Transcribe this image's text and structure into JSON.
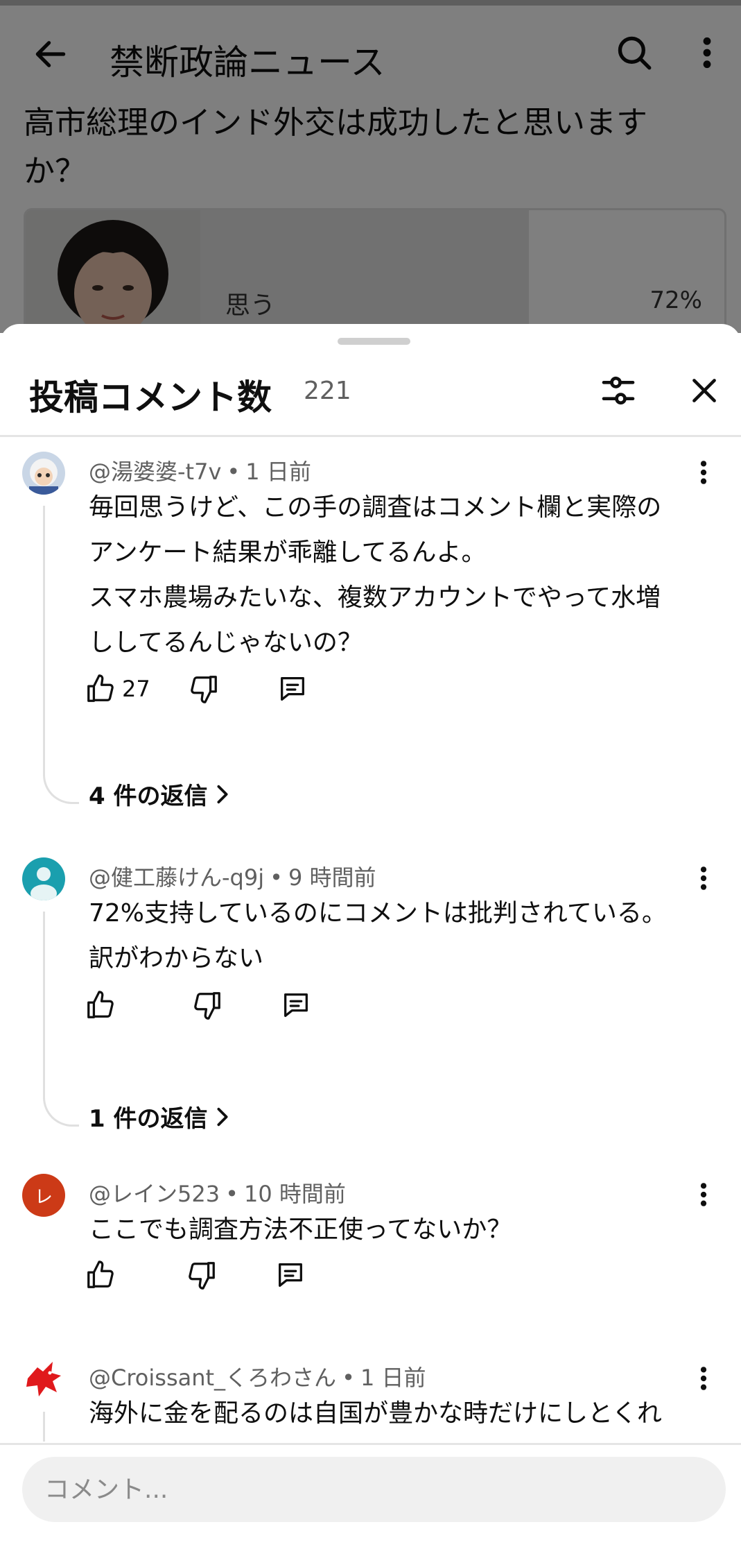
{
  "app": {
    "title": "禁断政論ニュース"
  },
  "post": {
    "question": "高市総理のインド外交は成功したと思いますか？",
    "poll": {
      "option_label": "思う",
      "percent_text": "72%",
      "percent_value": 72
    }
  },
  "sheet": {
    "title": "投稿コメント数",
    "count": "221"
  },
  "comments": [
    {
      "author": "@湯婆婆-t7v",
      "time": "1 日前",
      "text": "毎回思うけど、この手の調査はコメント欄と実際のアンケート結果が乖離してるんよ。\nスマホ農場みたいな、複数アカウントでやって水増ししてるんじゃないの？",
      "likes": "27",
      "replies": "4 件の返信",
      "avatar_icon": "cartoon-character-avatar"
    },
    {
      "author": "@健工藤けん-q9j",
      "time": "9 時間前",
      "text": "72%支持しているのにコメントは批判されている。\n訳がわからない",
      "likes": "",
      "replies": "1 件の返信",
      "avatar_icon": "default-person-avatar"
    },
    {
      "author": "@レイン523",
      "time": "10 時間前",
      "text": "ここでも調査方法不正使ってないか？",
      "likes": "",
      "replies": "",
      "avatar_letter": "レ",
      "avatar_color": "#cc3a17"
    },
    {
      "author": "@Croissant_くろわさん",
      "time": "1 日前",
      "text": "海外に金を配るのは自国が豊かな時だけにしとくれ",
      "likes": "",
      "replies": "",
      "avatar_icon": "red-dragon-avatar"
    }
  ],
  "composer": {
    "placeholder": "コメント..."
  },
  "colors": {
    "overlay": "rgba(0,0,0,0.5)",
    "text_primary": "#0f0f0f",
    "text_secondary": "#606060",
    "avatar_teal": "#1a9fae",
    "avatar_red": "#cc3a17"
  }
}
